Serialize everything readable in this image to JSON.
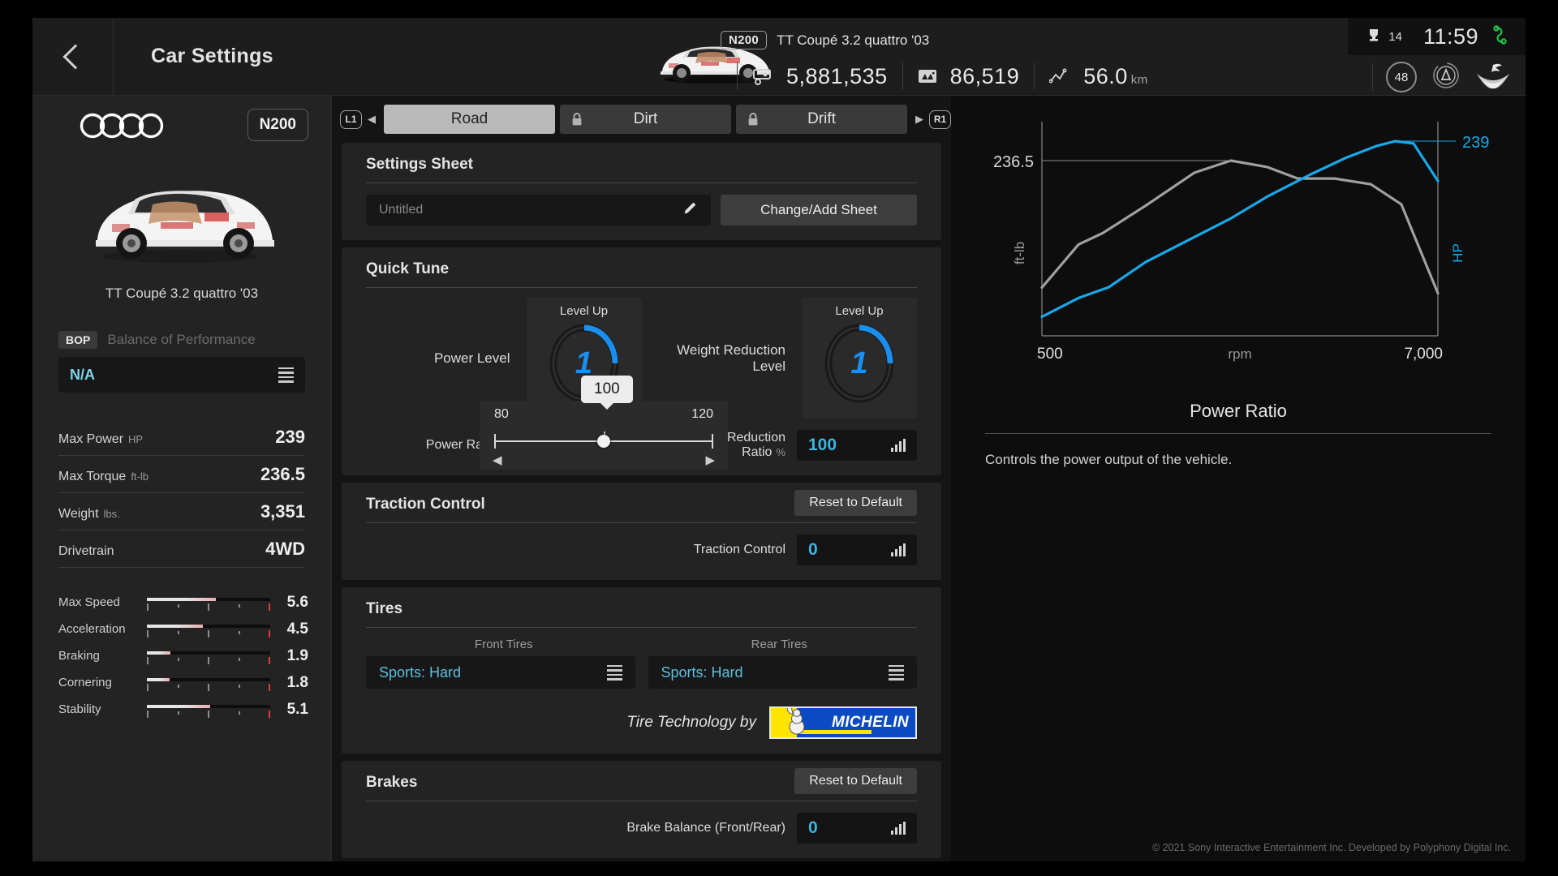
{
  "header": {
    "back_icon": "chevron-left-icon",
    "title": "Car Settings",
    "car_class_badge": "N200",
    "car_name": "TT Coupé 3.2 quattro '03",
    "credits_icon": "credits-icon",
    "credits": "5,881,535",
    "mileage_icon": "mileage-icon",
    "mileage": "86,519",
    "distance_icon": "graph-icon",
    "distance": "56.0",
    "distance_unit": "km",
    "trophy_icon": "trophy-icon",
    "trophy_count": "14",
    "clock": "11:59",
    "network_icon": "network-icon",
    "level": "48",
    "collector_icon": "collector-icon",
    "brand_icon": "gt-sophy-icon"
  },
  "sidebar": {
    "brand_icon": "audi-rings-icon",
    "class_badge": "N200",
    "car_image": "audi-tt-coupe-image",
    "car_name": "TT Coupé 3.2 quattro '03",
    "bop_tag": "BOP",
    "bop_label": "Balance of Performance",
    "bop_value": "N/A",
    "bop_menu_icon": "list-menu-icon",
    "specs": [
      {
        "name": "Max Power",
        "unit": "HP",
        "value": "239"
      },
      {
        "name": "Max Torque",
        "unit": "ft-lb",
        "value": "236.5"
      },
      {
        "name": "Weight",
        "unit": "lbs.",
        "value": "3,351"
      },
      {
        "name": "Drivetrain",
        "unit": "",
        "value": "4WD"
      }
    ],
    "performance": [
      {
        "name": "Max Speed",
        "value": "5.6",
        "pct": 56
      },
      {
        "name": "Acceleration",
        "value": "4.5",
        "pct": 45
      },
      {
        "name": "Braking",
        "value": "1.9",
        "pct": 19
      },
      {
        "name": "Cornering",
        "value": "1.8",
        "pct": 18
      },
      {
        "name": "Stability",
        "value": "5.1",
        "pct": 51
      }
    ]
  },
  "main": {
    "shoulder_left": "L1",
    "shoulder_right": "R1",
    "tabs": [
      {
        "label": "Road",
        "locked": false
      },
      {
        "label": "Dirt",
        "locked": true
      },
      {
        "label": "Drift",
        "locked": true
      }
    ],
    "settings_sheet": {
      "title": "Settings Sheet",
      "sheet_name": "Untitled",
      "edit_icon": "pencil-icon",
      "change_button": "Change/Add Sheet"
    },
    "quick_tune": {
      "title": "Quick Tune",
      "power": {
        "label": "Power Level",
        "level_up": "Level Up",
        "dial_value": "1",
        "ratio_label": "Power Ratio",
        "ratio_unit": "%",
        "ratio_value": "100",
        "bars_icon": "bar-adjust-icon"
      },
      "weight": {
        "label": "Weight Reduction Level",
        "level_up": "Level Up",
        "dial_value": "1",
        "ratio_label": "Weight Reduction Ratio",
        "ratio_unit": "%",
        "ratio_value": "100",
        "bars_icon": "bar-adjust-icon"
      }
    },
    "slider_popup": {
      "tooltip_value": "100",
      "min": "80",
      "max": "120",
      "left_arrow_icon": "triangle-left-icon",
      "right_arrow_icon": "triangle-right-icon"
    },
    "traction": {
      "title": "Traction Control",
      "reset_button": "Reset to Default",
      "row_label": "Traction Control",
      "value": "0",
      "bars_icon": "bar-adjust-icon"
    },
    "tires": {
      "title": "Tires",
      "front_header": "Front Tires",
      "rear_header": "Rear Tires",
      "front_value": "Sports: Hard",
      "rear_value": "Sports: Hard",
      "menu_icon": "list-menu-icon",
      "tire_tech_text": "Tire Technology by",
      "brand": "MICHELIN"
    },
    "brakes": {
      "title": "Brakes",
      "reset_button": "Reset to Default",
      "row_label": "Brake Balance (Front/Rear)",
      "value": "0",
      "bars_icon": "bar-adjust-icon"
    }
  },
  "right_panel": {
    "description_title": "Power Ratio",
    "description_body": "Controls the power output of the vehicle.",
    "copyright": "© 2021 Sony Interactive Entertainment Inc. Developed by Polyphony Digital Inc."
  },
  "colors": {
    "accent_blue": "#1b8ff0",
    "value_cyan": "#3fb3e0",
    "hp_curve": "#18a8e8",
    "torque_curve": "#a0a0a0",
    "stage_bg": "#141414",
    "sidebar_bg": "#232323"
  },
  "chart_data": {
    "type": "line",
    "title": "",
    "xlabel": "rpm",
    "x_tick_min": "500",
    "x_tick_max": "7,000",
    "xlim": [
      500,
      7000
    ],
    "grid": false,
    "legend": "right/left axis labels",
    "series": [
      {
        "name": "ft-lb",
        "axis": "left",
        "axis_label": "ft-lb",
        "color": "#a0a0a0",
        "peak_label": "236.5",
        "peak_value": 236.5,
        "x": [
          500,
          1100,
          1500,
          2200,
          3000,
          3600,
          4200,
          4700,
          5300,
          5900,
          6400,
          7000
        ],
        "y": [
          148,
          178,
          186,
          205,
          228,
          236.5,
          232,
          224,
          224,
          220,
          206,
          144
        ]
      },
      {
        "name": "HP",
        "axis": "right",
        "axis_label": "HP",
        "color": "#18a8e8",
        "peak_label": "239",
        "peak_value": 239,
        "x": [
          500,
          1100,
          1600,
          2200,
          2900,
          3600,
          4200,
          4900,
          5500,
          6000,
          6300,
          6600,
          7000
        ],
        "y": [
          14,
          38,
          52,
          84,
          112,
          140,
          168,
          196,
          218,
          233,
          239,
          236,
          188
        ]
      }
    ]
  }
}
